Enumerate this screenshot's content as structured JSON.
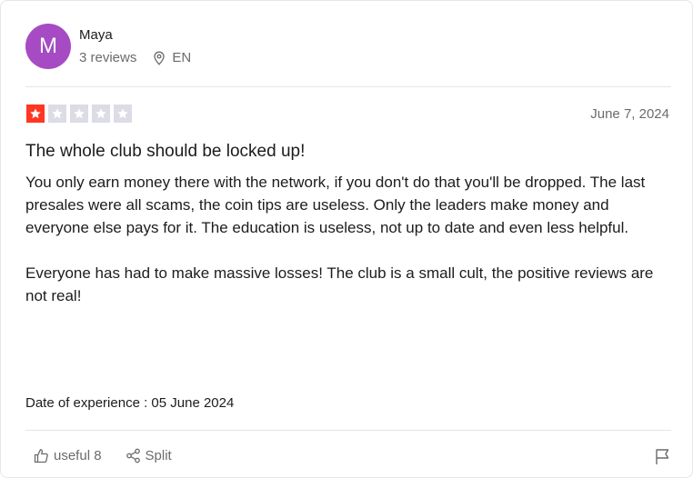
{
  "reviewer": {
    "avatar_initial": "M",
    "avatar_color": "#a64bc4",
    "name": "Maya",
    "review_count": "3 reviews",
    "locale": "EN"
  },
  "review": {
    "rating": 1,
    "max_rating": 5,
    "rating_color": "#ff3722",
    "empty_star_color": "#dcdce6",
    "date": "June 7, 2024",
    "title": "The whole club should be locked up!",
    "paragraphs": [
      "You only earn money there with the network, if you don't do that you'll be dropped. The last presales were all scams, the coin tips are useless. Only the leaders make money and everyone else pays for it. The education is useless, not up to date and even less helpful.",
      "Everyone has had to make massive losses! The club is a small cult, the positive reviews are not real!"
    ],
    "experience_label": "Date of experience : 05 June 2024"
  },
  "actions": {
    "useful_label": "useful 8",
    "share_label": "Split",
    "useful_icon": "thumbs-up-icon",
    "share_icon": "share-icon",
    "flag_icon": "flag-icon"
  }
}
